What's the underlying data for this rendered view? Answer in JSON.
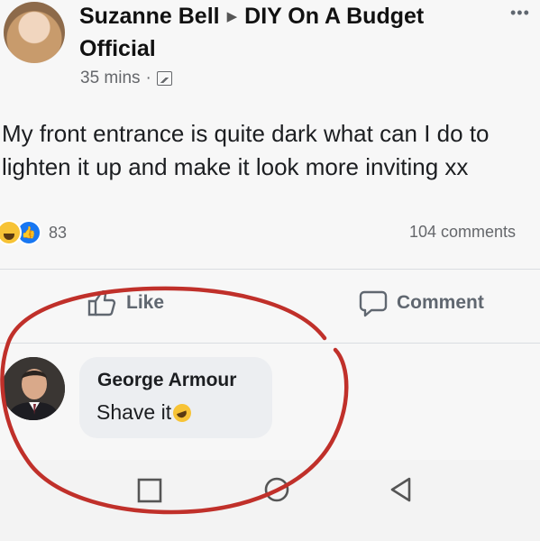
{
  "post": {
    "author": "Suzanne Bell",
    "group": "DIY On A Budget Official",
    "time": "35 mins",
    "visibility_icon": "public-icon",
    "text": "My front entrance is quite dark what can I do to\nlighten it up and make it look more inviting xx",
    "reactions": {
      "icons": [
        "haha-reaction-icon",
        "like-reaction-icon"
      ],
      "count": "83"
    },
    "comments_count": "104 comments"
  },
  "actions": {
    "like_label": "Like",
    "comment_label": "Comment"
  },
  "comment": {
    "author": "George Armour",
    "text": "Shave it",
    "emoji": "laughing-emoji"
  },
  "navbar": {
    "buttons": [
      "recents-square-icon",
      "home-circle-icon",
      "back-triangle-icon"
    ]
  },
  "colors": {
    "annotation": "#c0302a",
    "link_blue": "#1877f2",
    "secondary_text": "#65676b"
  }
}
